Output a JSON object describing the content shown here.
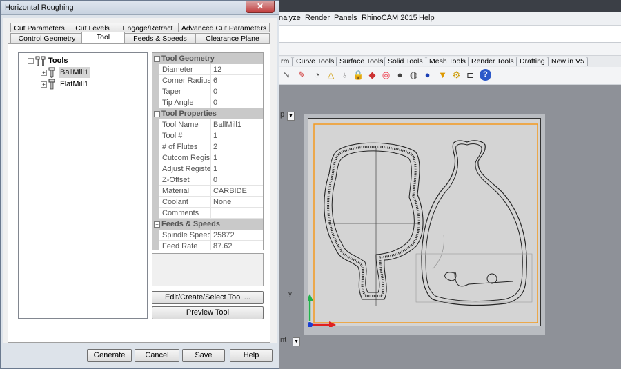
{
  "background_app": {
    "menu": [
      "nalyze",
      "Render",
      "Panels",
      "RhinoCAM 2015",
      "Help"
    ],
    "tabs": [
      "rm",
      "Curve Tools",
      "Surface Tools",
      "Solid Tools",
      "Mesh Tools",
      "Render Tools",
      "Drafting",
      "New in V5"
    ],
    "viewport_label_top": "p",
    "viewport_label_bottom": "nt",
    "axis_label": "y"
  },
  "dialog": {
    "title": "Horizontal Roughing",
    "close_label": "✕",
    "tabs_row1": [
      "Cut Parameters",
      "Cut Levels",
      "Engage/Retract",
      "Advanced Cut Parameters"
    ],
    "tabs_row2": [
      "Control Geometry",
      "Tool",
      "Feeds & Speeds",
      "Clearance Plane"
    ],
    "active_tab": "Tool",
    "tree": {
      "root": "Tools",
      "items": [
        "BallMill1",
        "FlatMill1"
      ],
      "selected": "BallMill1",
      "expander_collapsed": "+",
      "expander_expanded": "−"
    },
    "properties": {
      "geometry": {
        "title": "Tool Geometry",
        "rows": [
          {
            "name": "Diameter",
            "value": "12"
          },
          {
            "name": "Corner Radius",
            "value": "6"
          },
          {
            "name": "Taper",
            "value": "0"
          },
          {
            "name": "Tip Angle",
            "value": "0"
          }
        ]
      },
      "props": {
        "title": "Tool Properties",
        "rows": [
          {
            "name": "Tool Name",
            "value": "BallMill1"
          },
          {
            "name": "Tool #",
            "value": "1"
          },
          {
            "name": "# of Flutes",
            "value": "2"
          },
          {
            "name": "Cutcom Registe",
            "value": "1"
          },
          {
            "name": "Adjust Register",
            "value": "1"
          },
          {
            "name": "Z-Offset",
            "value": "0"
          },
          {
            "name": "Material",
            "value": " CARBIDE"
          },
          {
            "name": "Coolant",
            "value": "None"
          },
          {
            "name": "Comments",
            "value": ""
          }
        ]
      },
      "feeds": {
        "title": "Feeds & Speeds",
        "rows": [
          {
            "name": "Spindle Speed",
            "value": "25872"
          },
          {
            "name": "Feed Rate",
            "value": "87.62"
          }
        ]
      }
    },
    "buttons": {
      "edit_tool": "Edit/Create/Select Tool ...",
      "preview_tool": "Preview Tool",
      "generate": "Generate",
      "cancel": "Cancel",
      "save": "Save",
      "help": "Help"
    }
  },
  "colors": {
    "orange_border": "#f39a1e",
    "axis_green": "#22b14c",
    "axis_red": "#e02020",
    "axis_blue": "#1a3fd1"
  }
}
